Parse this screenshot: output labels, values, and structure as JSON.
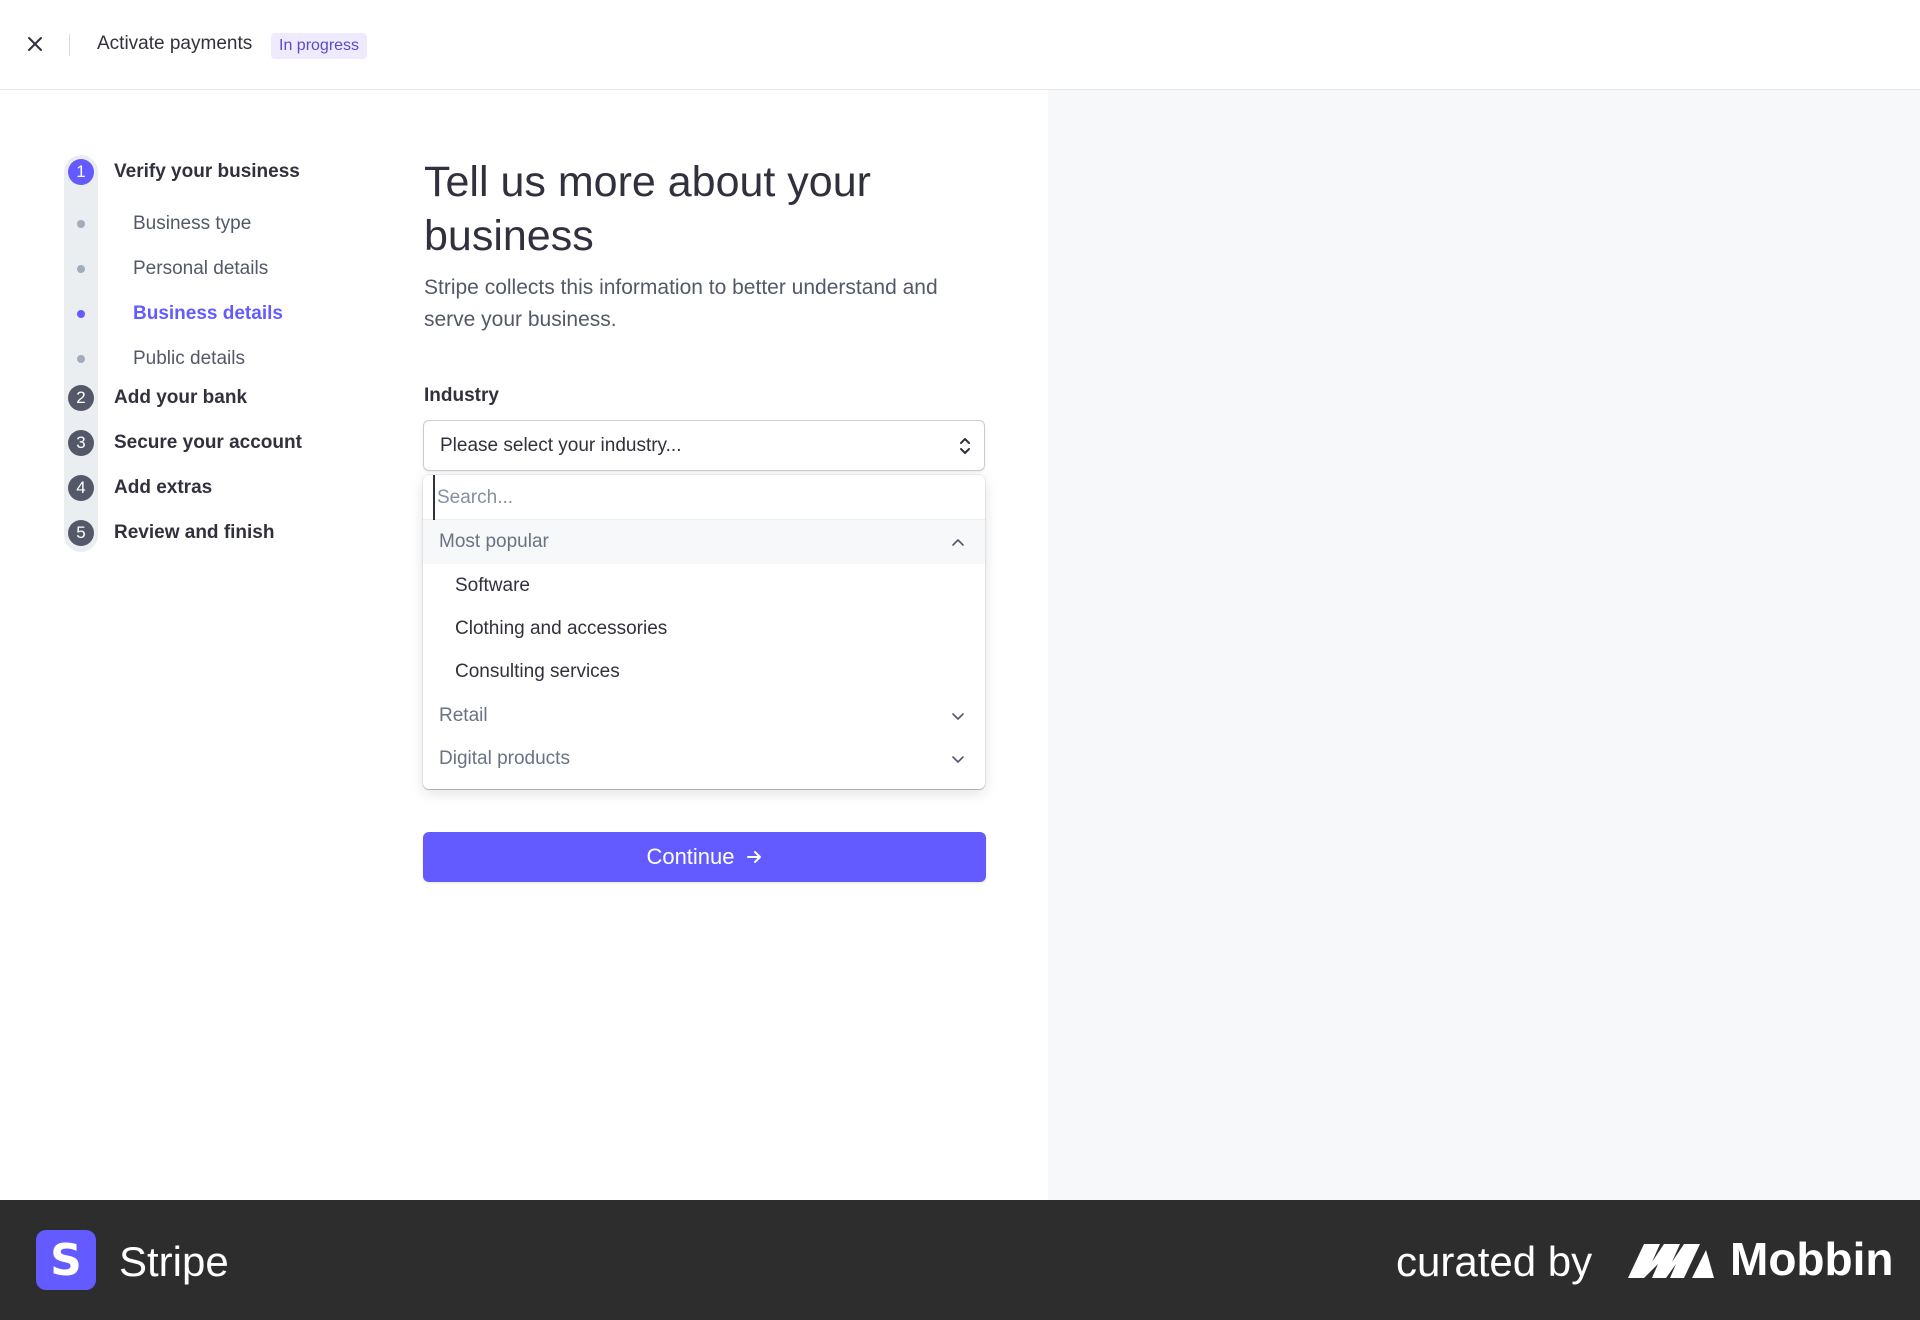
{
  "header": {
    "title": "Activate payments",
    "status_badge": "In progress"
  },
  "steps": [
    {
      "number": "1",
      "label": "Verify your business",
      "active": true
    },
    {
      "number": "2",
      "label": "Add your bank",
      "active": false
    },
    {
      "number": "3",
      "label": "Secure your account",
      "active": false
    },
    {
      "number": "4",
      "label": "Add extras",
      "active": false
    },
    {
      "number": "5",
      "label": "Review and finish",
      "active": false
    }
  ],
  "substeps": [
    {
      "label": "Business type",
      "active": false
    },
    {
      "label": "Personal details",
      "active": false
    },
    {
      "label": "Business details",
      "active": true
    },
    {
      "label": "Public details",
      "active": false
    }
  ],
  "main": {
    "heading": "Tell us more about your business",
    "subtext": "Stripe collects this information to better understand and serve your business.",
    "industry_label": "Industry",
    "industry_select_value": "Please select your industry...",
    "continue_label": "Continue"
  },
  "dropdown": {
    "search_placeholder": "Search...",
    "groups": [
      {
        "label": "Most popular",
        "expanded": true,
        "items": [
          "Software",
          "Clothing and accessories",
          "Consulting services"
        ]
      },
      {
        "label": "Retail",
        "expanded": false
      },
      {
        "label": "Digital products",
        "expanded": false
      }
    ]
  },
  "footer": {
    "brand_initial": "S",
    "brand_name": "Stripe",
    "curated_by": "curated by",
    "mobbin_name": "Mobbin"
  },
  "colors": {
    "accent": "#635bff",
    "badge_bg": "#efeafe",
    "right_panel": "#f6f8fa",
    "footer": "#2d2d2d"
  }
}
